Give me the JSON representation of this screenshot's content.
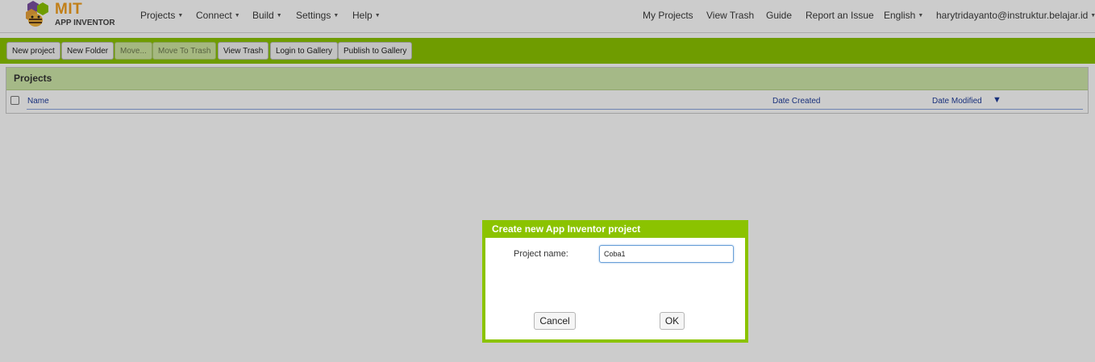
{
  "logo": {
    "line1": "MIT",
    "line2": "APP INVENTOR"
  },
  "nav_left": [
    {
      "label": "Projects"
    },
    {
      "label": "Connect"
    },
    {
      "label": "Build"
    },
    {
      "label": "Settings"
    },
    {
      "label": "Help"
    }
  ],
  "nav_right": {
    "my_projects": "My Projects",
    "view_trash": "View Trash",
    "guide": "Guide",
    "report_issue": "Report an Issue",
    "language": "English",
    "account": "harytridayanto@instruktur.belajar.id"
  },
  "toolbar": {
    "new_project": "New project",
    "new_folder": "New Folder",
    "move": "Move...",
    "move_to_trash": "Move To Trash",
    "view_trash": "View Trash",
    "login_gallery": "Login to Gallery",
    "publish_gallery": "Publish to Gallery"
  },
  "projects_panel": {
    "title": "Projects",
    "columns": {
      "name": "Name",
      "date_created": "Date Created",
      "date_modified": "Date Modified"
    }
  },
  "dialog": {
    "title": "Create new App Inventor project",
    "field_label": "Project name:",
    "field_value": "Coba1",
    "cancel_label": "Cancel",
    "ok_label": "OK"
  },
  "colors": {
    "accent_green": "#8bc300",
    "header_green": "#cfe8a9",
    "link_blue": "#1e3c9a"
  }
}
